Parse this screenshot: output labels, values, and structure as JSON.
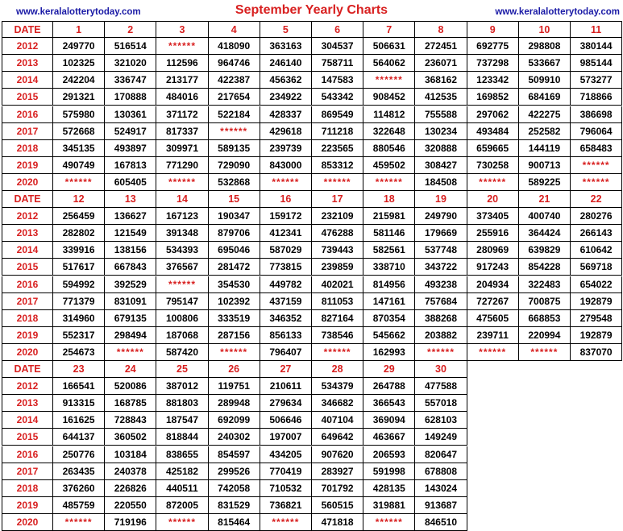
{
  "header": {
    "site_left": "www.keralalotterytoday.com",
    "title": "September Yearly Charts",
    "site_right": "www.keralalotterytoday.com"
  },
  "colors": {
    "accent_red": "#d82020",
    "link_blue": "#1a1aa6"
  },
  "years": [
    "2012",
    "2013",
    "2014",
    "2015",
    "2016",
    "2017",
    "2018",
    "2019",
    "2020"
  ],
  "sections": [
    {
      "date_label": "DATE",
      "days": [
        "1",
        "2",
        "3",
        "4",
        "5",
        "6",
        "7",
        "8",
        "9",
        "10",
        "11"
      ],
      "rows": [
        [
          "249770",
          "516514",
          "******",
          "418090",
          "363163",
          "304537",
          "506631",
          "272451",
          "692775",
          "298808",
          "380144"
        ],
        [
          "102325",
          "321020",
          "112596",
          "964746",
          "246140",
          "758711",
          "564062",
          "236071",
          "737298",
          "533667",
          "985144"
        ],
        [
          "242204",
          "336747",
          "213177",
          "422387",
          "456362",
          "147583",
          "******",
          "368162",
          "123342",
          "509910",
          "573277"
        ],
        [
          "291321",
          "170888",
          "484016",
          "217654",
          "234922",
          "543342",
          "908452",
          "412535",
          "169852",
          "684169",
          "718866"
        ],
        [
          "575980",
          "130361",
          "371172",
          "522184",
          "428337",
          "869549",
          "114812",
          "755588",
          "297062",
          "422275",
          "386698"
        ],
        [
          "572668",
          "524917",
          "817337",
          "******",
          "429618",
          "711218",
          "322648",
          "130234",
          "493484",
          "252582",
          "796064"
        ],
        [
          "345135",
          "493897",
          "309971",
          "589135",
          "239739",
          "223565",
          "880546",
          "320888",
          "659665",
          "144119",
          "658483"
        ],
        [
          "490749",
          "167813",
          "771290",
          "729090",
          "843000",
          "853312",
          "459502",
          "308427",
          "730258",
          "900713",
          "******"
        ],
        [
          "******",
          "605405",
          "******",
          "532868",
          "******",
          "******",
          "******",
          "184508",
          "******",
          "589225",
          "******"
        ]
      ]
    },
    {
      "date_label": "DATE",
      "days": [
        "12",
        "13",
        "14",
        "15",
        "16",
        "17",
        "18",
        "19",
        "20",
        "21",
        "22"
      ],
      "rows": [
        [
          "256459",
          "136627",
          "167123",
          "190347",
          "159172",
          "232109",
          "215981",
          "249790",
          "373405",
          "400740",
          "280276"
        ],
        [
          "282802",
          "121549",
          "391348",
          "879706",
          "412341",
          "476288",
          "581146",
          "179669",
          "255916",
          "364424",
          "266143"
        ],
        [
          "339916",
          "138156",
          "534393",
          "695046",
          "587029",
          "739443",
          "582561",
          "537748",
          "280969",
          "639829",
          "610642"
        ],
        [
          "517617",
          "667843",
          "376567",
          "281472",
          "773815",
          "239859",
          "338710",
          "343722",
          "917243",
          "854228",
          "569718"
        ],
        [
          "594992",
          "392529",
          "******",
          "354530",
          "449782",
          "402021",
          "814956",
          "493238",
          "204934",
          "322483",
          "654022"
        ],
        [
          "771379",
          "831091",
          "795147",
          "102392",
          "437159",
          "811053",
          "147161",
          "757684",
          "727267",
          "700875",
          "192879"
        ],
        [
          "314960",
          "679135",
          "100806",
          "333519",
          "346352",
          "827164",
          "870354",
          "388268",
          "475605",
          "668853",
          "279548"
        ],
        [
          "552317",
          "298494",
          "187068",
          "287156",
          "856133",
          "738546",
          "545662",
          "203882",
          "239711",
          "220994",
          "192879"
        ],
        [
          "254673",
          "******",
          "587420",
          "******",
          "796407",
          "******",
          "162993",
          "******",
          "******",
          "******",
          "837070"
        ]
      ]
    },
    {
      "date_label": "DATE",
      "days": [
        "23",
        "24",
        "25",
        "26",
        "27",
        "28",
        "29",
        "30"
      ],
      "rows": [
        [
          "166541",
          "520086",
          "387012",
          "119751",
          "210611",
          "534379",
          "264788",
          "477588"
        ],
        [
          "913315",
          "168785",
          "881803",
          "289948",
          "279634",
          "346682",
          "366543",
          "557018"
        ],
        [
          "161625",
          "728843",
          "187547",
          "692099",
          "506646",
          "407104",
          "369094",
          "628103"
        ],
        [
          "644137",
          "360502",
          "818844",
          "240302",
          "197007",
          "649642",
          "463667",
          "149249"
        ],
        [
          "250776",
          "103184",
          "838655",
          "854597",
          "434205",
          "907620",
          "206593",
          "820647"
        ],
        [
          "263435",
          "240378",
          "425182",
          "299526",
          "770419",
          "283927",
          "591998",
          "678808"
        ],
        [
          "376260",
          "226826",
          "440511",
          "742058",
          "710532",
          "701792",
          "428135",
          "143024"
        ],
        [
          "485759",
          "220550",
          "872005",
          "831529",
          "736821",
          "560515",
          "319881",
          "913687"
        ],
        [
          "******",
          "719196",
          "******",
          "815464",
          "******",
          "471818",
          "******",
          "846510"
        ]
      ]
    }
  ]
}
